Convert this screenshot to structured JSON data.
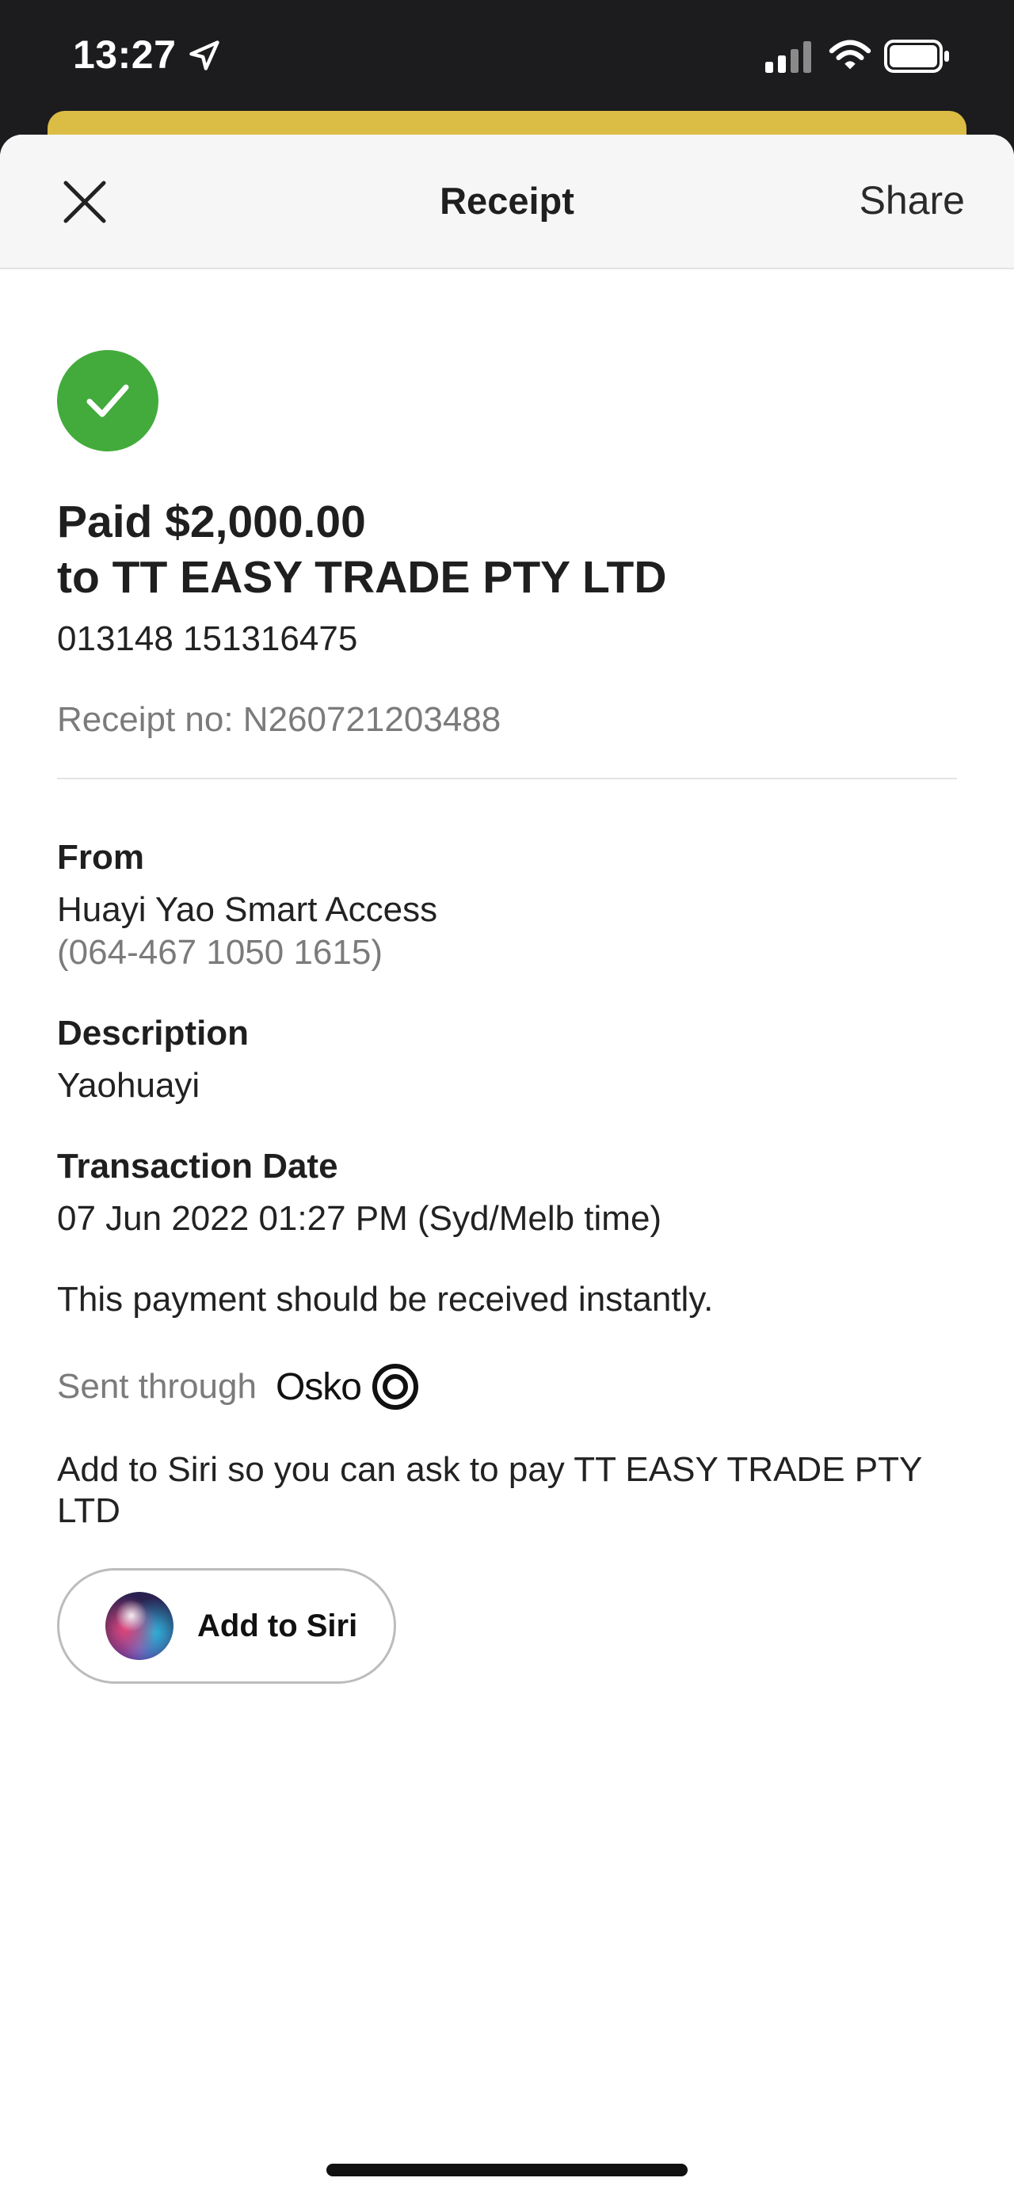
{
  "status_bar": {
    "time": "13:27",
    "icons": [
      "location-arrow-icon",
      "cellular-signal-icon",
      "wifi-icon",
      "battery-icon"
    ]
  },
  "nav": {
    "title": "Receipt",
    "close_icon": "close-icon",
    "share_label": "Share"
  },
  "receipt": {
    "status_icon": "checkmark-circle-icon",
    "status_color": "#43ab3c",
    "paid_line": "Paid $2,000.00",
    "payee_line": "to TT EASY TRADE PTY LTD",
    "payee_account": "013148 151316475",
    "receipt_no": "Receipt no: N260721203488"
  },
  "details": {
    "from_label": "From",
    "from_name": "Huayi Yao Smart Access",
    "from_account": "(064-467 1050 1615)",
    "description_label": "Description",
    "description_value": "Yaohuayi",
    "date_label": "Transaction Date",
    "date_value": "07 Jun 2022 01:27 PM (Syd/Melb time)",
    "instant_note": "This payment should be received instantly.",
    "sent_through_label": "Sent through",
    "osko_name": "Osko"
  },
  "siri": {
    "prompt": "Add to Siri so you can ask to pay TT EASY TRADE PTY LTD",
    "button_label": "Add to Siri"
  },
  "colors": {
    "accent_yellow": "#dbbc45",
    "success_green": "#43ab3c",
    "status_bar_bg": "#1c1c1e"
  }
}
